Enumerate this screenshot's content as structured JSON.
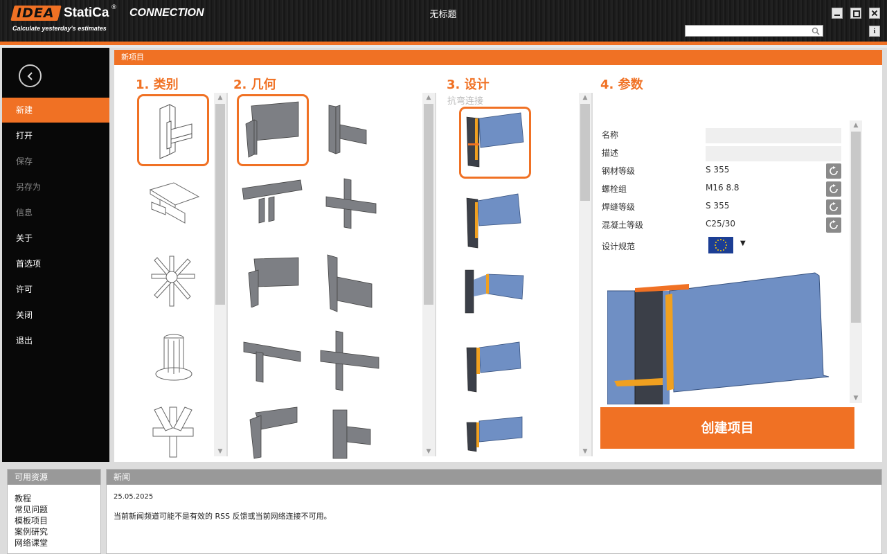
{
  "app": {
    "brand_idea": "IDEA",
    "brand_statica": "StatiCa",
    "brand_reg": "®",
    "product": "CONNECTION",
    "tagline": "Calculate yesterday's estimates",
    "window_title": "无标题",
    "search_placeholder": "",
    "info_label": "i"
  },
  "sidebar": {
    "items": [
      {
        "label": "新建",
        "state": "active"
      },
      {
        "label": "打开",
        "state": "normal"
      },
      {
        "label": "保存",
        "state": "disabled"
      },
      {
        "label": "另存为",
        "state": "disabled"
      },
      {
        "label": "信息",
        "state": "disabled"
      },
      {
        "label": "关于",
        "state": "normal"
      },
      {
        "label": "首选项",
        "state": "normal"
      },
      {
        "label": "许可",
        "state": "normal"
      },
      {
        "label": "关闭",
        "state": "normal"
      },
      {
        "label": "退出",
        "state": "normal"
      }
    ]
  },
  "main": {
    "header": "新项目",
    "step1": {
      "title": "1. 类别"
    },
    "step2": {
      "title": "2. 几何"
    },
    "step3": {
      "title": "3. 设计",
      "subtitle": "抗弯连接"
    },
    "step4": {
      "title": "4. 参数"
    },
    "params": {
      "name_label": "名称",
      "name_value": "",
      "desc_label": "描述",
      "desc_value": "",
      "steel_label": "钢材等级",
      "steel_value": "S 355",
      "bolt_label": "螺栓组",
      "bolt_value": "M16 8.8",
      "weld_label": "焊缝等级",
      "weld_value": "S 355",
      "concrete_label": "混凝土等级",
      "concrete_value": "C25/30",
      "code_label": "设计规范",
      "code_selected": "EU-flag-icon"
    },
    "create_button": "创建项目"
  },
  "resources": {
    "header": "可用资源",
    "links": [
      "教程",
      "常见问题",
      "模板项目",
      "案例研究",
      "网络课堂"
    ]
  },
  "news": {
    "header": "新闻",
    "date": "25.05.2025",
    "message": "当前新闻频道可能不是有效的 RSS 反馈或当前网络连接不可用。"
  },
  "colors": {
    "accent": "#f07124",
    "sidebar_bg": "#080808",
    "steel_blue": "#6f8fc4",
    "steel_grey": "#7d7f84"
  }
}
